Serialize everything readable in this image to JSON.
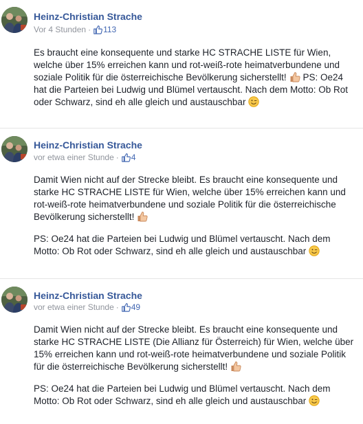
{
  "posts": [
    {
      "author": "Heinz-Christian Strache",
      "time": "Vor 4 Stunden",
      "likes": "113",
      "paragraphs": [
        "Es braucht eine konsequente und starke HC STRACHE LISTE für Wien, welche über 15% erreichen kann und rot-weiß-rote heimatverbundene und soziale Politik für die österreichische Bevölkerung sicherstellt!",
        "PS: Oe24 hat die Parteien bei Ludwig und Blümel vertauscht. Nach dem Motto: Ob Rot oder Schwarz, sind eh alle gleich und austauschbar"
      ]
    },
    {
      "author": "Heinz-Christian Strache",
      "time": "vor etwa einer Stunde",
      "likes": "4",
      "paragraphs": [
        "Damit Wien nicht auf der Strecke bleibt. Es braucht eine konsequente und starke HC STRACHE LISTE für Wien, welche über 15% erreichen kann und rot-weiß-rote heimatverbundene und soziale Politik für die österreichische Bevölkerung sicherstellt!",
        "PS: Oe24 hat die Parteien bei Ludwig und Blümel vertauscht. Nach dem Motto: Ob Rot oder Schwarz, sind eh alle gleich und austauschbar"
      ]
    },
    {
      "author": "Heinz-Christian Strache",
      "time": "vor etwa einer Stunde",
      "likes": "49",
      "paragraphs": [
        "Damit Wien nicht auf der Strecke bleibt. Es braucht eine konsequente und starke HC STRACHE LISTE (Die Allianz für Österreich) für Wien, welche über 15% erreichen kann und rot-weiß-rote heimatverbundene und soziale Politik für die österreichische Bevölkerung sicherstellt!",
        "PS: Oe24 hat die Parteien bei Ludwig und Blümel vertauscht. Nach dem Motto: Ob Rot oder Schwarz, sind eh alle gleich und austauschbar"
      ]
    }
  ],
  "separator": "·",
  "icons": {
    "like": "thumbs-up-icon",
    "emoji_thumb": "thumbs-up-emoji-icon",
    "emoji_wink": "winking-face-emoji-icon"
  },
  "colors": {
    "author": "#365899",
    "meta": "#90949c",
    "like": "#4267b2",
    "text": "#1d2129"
  }
}
